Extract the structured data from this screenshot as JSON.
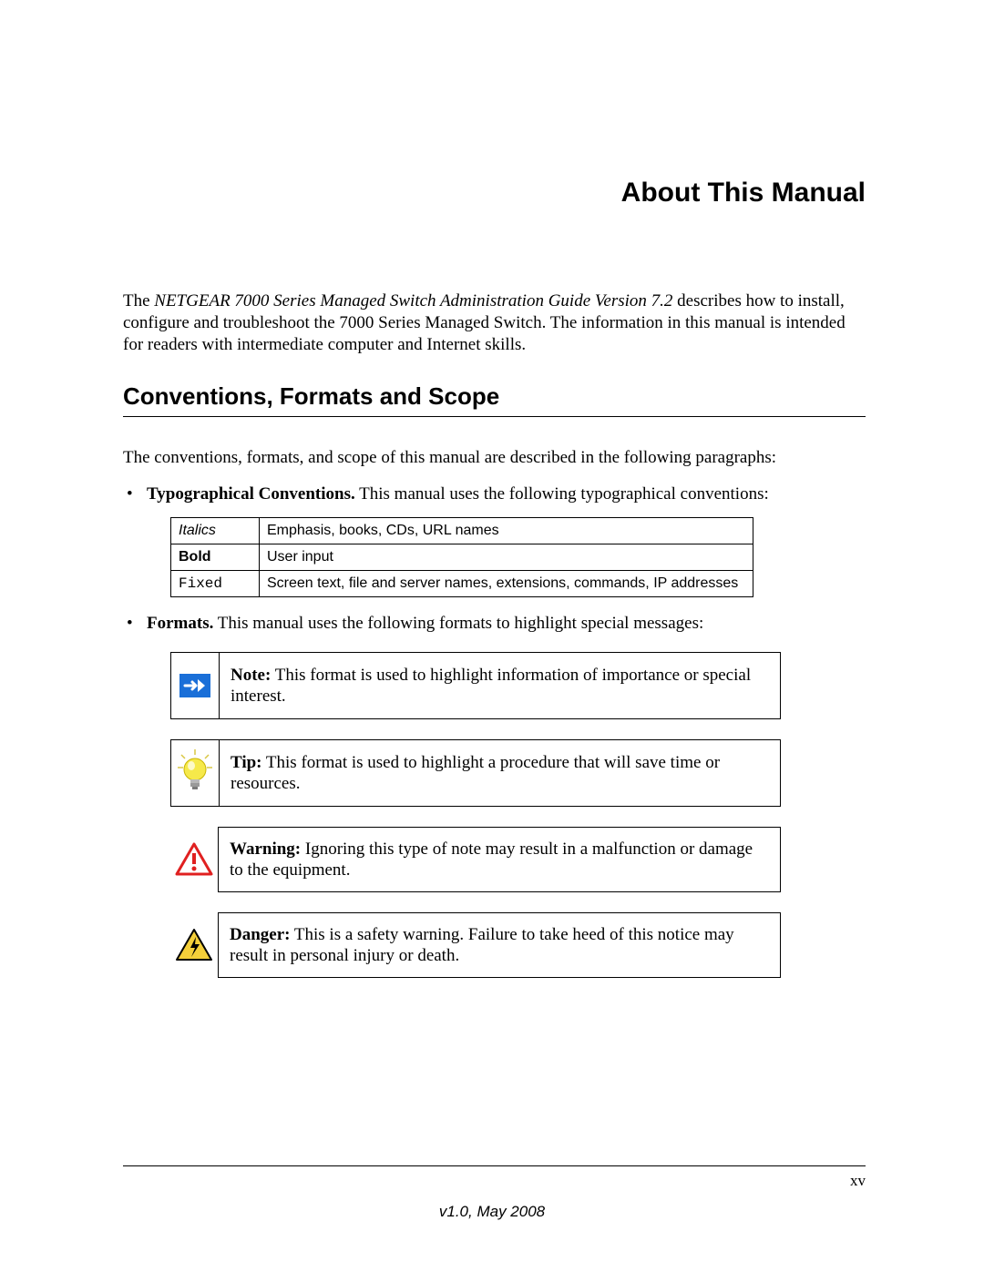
{
  "title": "About This Manual",
  "intro": {
    "prefix": "The ",
    "book_title": "NETGEAR 7000 Series Managed Switch Administration Guide Version 7.2",
    "suffix": " describes how to install, configure and troubleshoot the 7000 Series Managed Switch. The information in this manual is intended for readers with intermediate computer and Internet skills."
  },
  "section_heading": "Conventions, Formats and Scope",
  "section_intro": "The conventions, formats, and scope of this manual are described in the following paragraphs:",
  "bullet_typographical": {
    "lead": "Typographical Conventions.",
    "rest": " This manual uses the following typographical conventions:"
  },
  "conv_table": {
    "rows": [
      {
        "label": "Italics",
        "desc": "Emphasis, books, CDs, URL names"
      },
      {
        "label": "Bold",
        "desc": "User input"
      },
      {
        "label": "Fixed",
        "desc": "Screen text, file and server names, extensions, commands, IP addresses"
      }
    ]
  },
  "bullet_formats": {
    "lead": "Formats.",
    "rest": " This manual uses the following formats to highlight special messages:"
  },
  "callouts": {
    "note": {
      "lead": "Note:",
      "text": " This format is used to highlight information of importance or special interest."
    },
    "tip": {
      "lead": "Tip:",
      "text": " This format is used to highlight a procedure that will save time or resources."
    },
    "warning": {
      "lead": "Warning:",
      "text": " Ignoring this type of note may result in a malfunction or damage to the equipment."
    },
    "danger": {
      "lead": "Danger:",
      "text": " This is a safety warning. Failure to take heed of this notice may result in personal injury or death."
    }
  },
  "page_number": "xv",
  "version": "v1.0, May 2008"
}
